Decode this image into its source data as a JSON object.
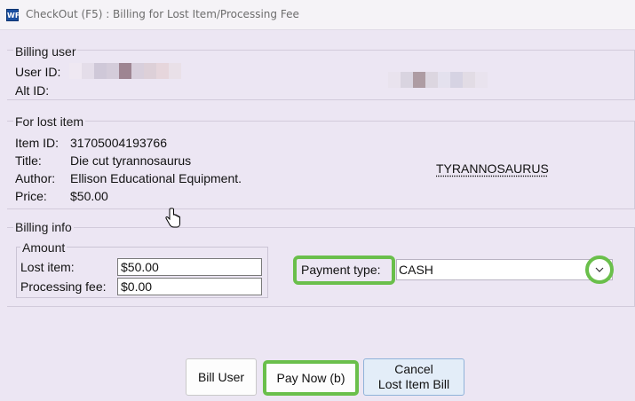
{
  "window": {
    "title": "CheckOut (F5) : Billing for Lost Item/Processing Fee",
    "app_icon": "WF"
  },
  "billing_user": {
    "legend": "Billing user",
    "user_id_label": "User ID:",
    "alt_id_label": "Alt ID:"
  },
  "lost_item": {
    "legend": "For lost item",
    "item_id_label": "Item ID:",
    "item_id": "31705004193766",
    "title_label": "Title:",
    "title": "Die cut tyrannosaurus",
    "author_label": "Author:",
    "author": "Ellison Educational Equipment.",
    "price_label": "Price:",
    "price": "$50.00",
    "call_label": "TYRANNOSAURUS"
  },
  "billing_info": {
    "legend": "Billing info",
    "amount_legend": "Amount",
    "lost_item_label": "Lost item:",
    "lost_item_value": "$50.00",
    "processing_fee_label": "Processing fee:",
    "processing_fee_value": "$0.00",
    "payment_type_label": "Payment type:",
    "payment_type_value": "CASH"
  },
  "buttons": {
    "bill_user": "Bill User",
    "pay_now": "Pay Now (b)",
    "cancel_line1": "Cancel",
    "cancel_line2": "Lost Item Bill"
  },
  "colors": {
    "highlight": "#6abf4b",
    "background": "#ece6f3",
    "cancel_button_bg": "#e3edf8"
  },
  "icons": {
    "app": "app-logo-icon",
    "cursor": "hand-pointer-icon",
    "dropdown": "chevron-down-icon"
  }
}
